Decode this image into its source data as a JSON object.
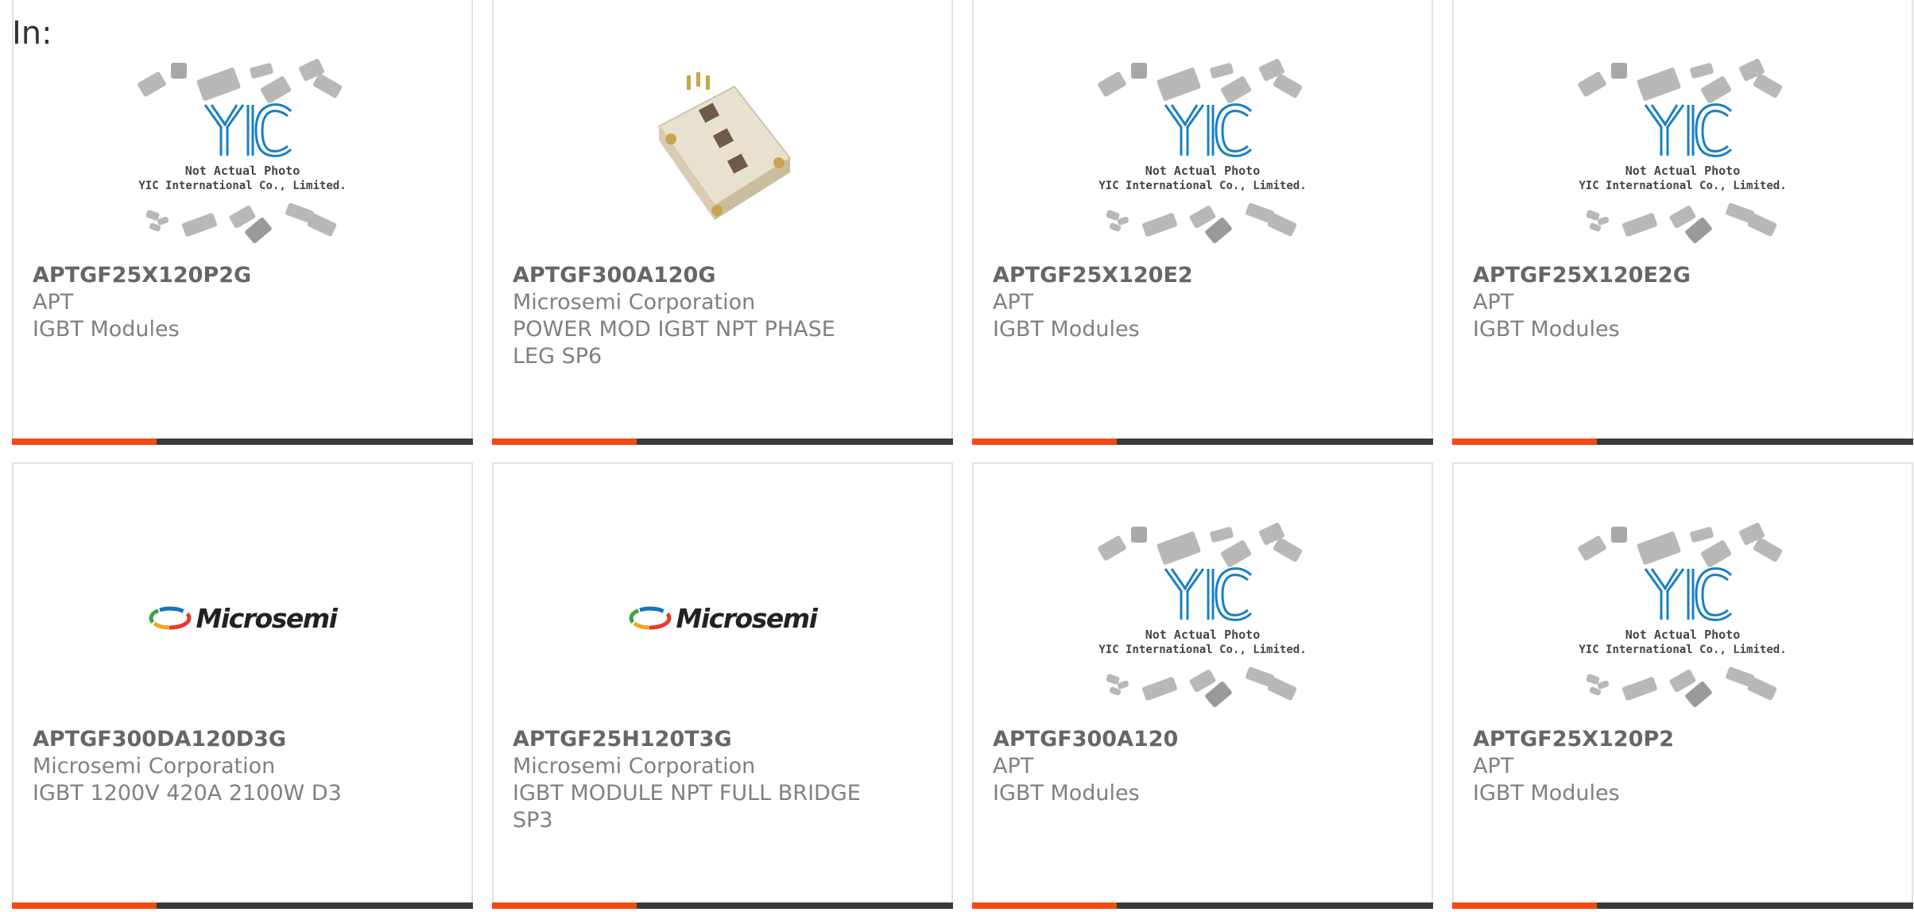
{
  "header": {
    "label": "In:"
  },
  "placeholder": {
    "line1": "Not Actual Photo",
    "line2": "YIC International Co., Limited.",
    "logo_text": "YIC"
  },
  "brand_logo": {
    "text": "Microsemi"
  },
  "colors": {
    "accent": "#f04a14",
    "bar": "#3a3a3a",
    "yic_blue": "#1a7fc0",
    "text": "#808080"
  },
  "products": [
    {
      "part": "APTGF25X120P2G",
      "mfr": "APT",
      "desc": "IGBT Modules",
      "image": "placeholder"
    },
    {
      "part": "APTGF300A120G",
      "mfr": "Microsemi Corporation",
      "desc": "POWER MOD IGBT NPT PHASE\nLEG SP6",
      "image": "module-photo"
    },
    {
      "part": "APTGF25X120E2",
      "mfr": "APT",
      "desc": "IGBT Modules",
      "image": "placeholder"
    },
    {
      "part": "APTGF25X120E2G",
      "mfr": "APT",
      "desc": "IGBT Modules",
      "image": "placeholder"
    },
    {
      "part": "APTGF300DA120D3G",
      "mfr": "Microsemi Corporation",
      "desc": "IGBT 1200V 420A 2100W D3",
      "image": "microsemi-logo"
    },
    {
      "part": "APTGF25H120T3G",
      "mfr": "Microsemi Corporation",
      "desc": "IGBT MODULE NPT FULL BRIDGE\nSP3",
      "image": "microsemi-logo"
    },
    {
      "part": "APTGF300A120",
      "mfr": "APT",
      "desc": "IGBT Modules",
      "image": "placeholder"
    },
    {
      "part": "APTGF25X120P2",
      "mfr": "APT",
      "desc": "IGBT Modules",
      "image": "placeholder"
    }
  ]
}
